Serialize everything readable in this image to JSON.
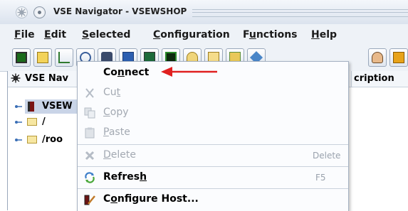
{
  "window": {
    "title": "VSE Navigator - VSEWSHOP"
  },
  "menubar": [
    {
      "prefix": "",
      "ul": "F",
      "rest": "ile"
    },
    {
      "prefix": "",
      "ul": "E",
      "rest": "dit"
    },
    {
      "prefix": "",
      "ul": "S",
      "rest": "elected"
    },
    {
      "prefix": "",
      "ul": "C",
      "rest": "onfiguration"
    },
    {
      "prefix": "F",
      "ul": "u",
      "rest": "nctions"
    },
    {
      "prefix": "",
      "ul": "H",
      "rest": "elp"
    }
  ],
  "toolbar": {
    "icons": [
      "monitor-icon",
      "window-copy-icon",
      "tree-icon",
      "search-folder-icon",
      "binoculars-icon",
      "console-icon",
      "terminal-icon",
      "dark-terminal-icon",
      "folder-search-icon",
      "folder-open-icon",
      "layout-icon",
      "diamond-icon",
      "user-icon",
      "bookmark-icon"
    ]
  },
  "tree": {
    "header_col1": "VSE Nav",
    "header_col2": "cription",
    "rows": [
      {
        "label": "VSEW",
        "selected": true
      },
      {
        "label": "/",
        "selected": false
      },
      {
        "label": "/roo",
        "selected": false
      }
    ]
  },
  "context_menu": {
    "items": [
      {
        "pre": "Co",
        "ul": "n",
        "post": "nect",
        "enabled": true,
        "shortcut": ""
      },
      {
        "pre": "Cu",
        "ul": "t",
        "post": "",
        "enabled": false,
        "shortcut": ""
      },
      {
        "pre": "",
        "ul": "C",
        "post": "opy",
        "enabled": false,
        "shortcut": ""
      },
      {
        "pre": "",
        "ul": "P",
        "post": "aste",
        "enabled": false,
        "shortcut": ""
      },
      {
        "pre": "",
        "ul": "D",
        "post": "elete",
        "enabled": false,
        "shortcut": "Delete"
      },
      {
        "pre": "Refres",
        "ul": "h",
        "post": "",
        "enabled": true,
        "shortcut": "F5"
      },
      {
        "pre": "C",
        "ul": "o",
        "post": "nfigure Host...",
        "enabled": true,
        "shortcut": ""
      }
    ]
  },
  "colors": {
    "accent_arrow": "#e02020",
    "selection": "#c9d4e7"
  }
}
